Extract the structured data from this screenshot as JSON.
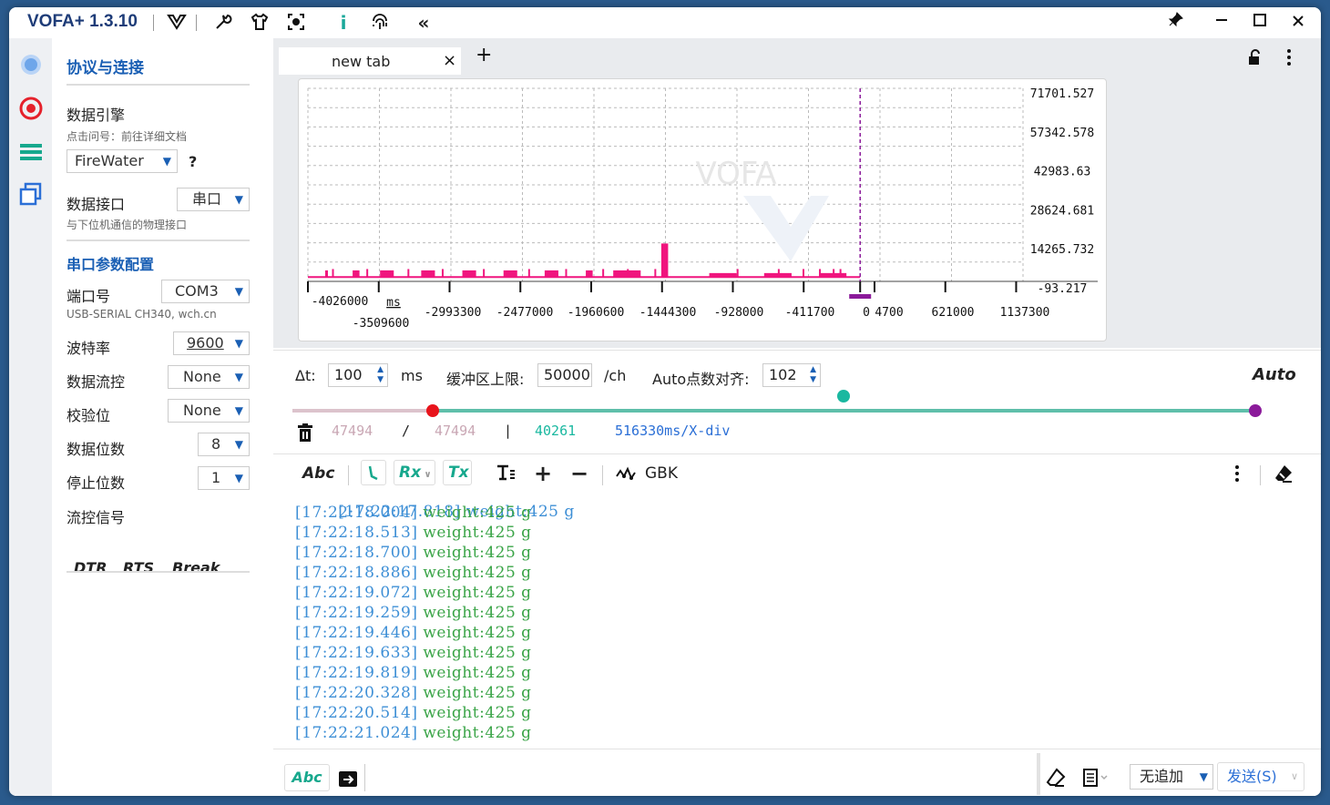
{
  "app": {
    "title": "VOFA+ 1.3.10",
    "toolbar_icons": [
      "vofa-logo-icon",
      "wrench-icon",
      "shirt-icon",
      "focus-icon",
      "info-icon",
      "fingerprint-icon",
      "collapse-icon"
    ],
    "window_controls": [
      "pin-icon",
      "minimize-icon",
      "maximize-icon",
      "close-icon"
    ]
  },
  "colors": {
    "accent": "#1a5fb4",
    "plot_series": "#f0157e",
    "cursor": "#8b1a9a",
    "slider_track": "#5fbfaa",
    "timestamp": "#3e8fd6",
    "message": "#3aa447",
    "muted_count": "#c9a7b4"
  },
  "sidebar": {
    "section_title": "协议与连接",
    "engine_label": "数据引擎",
    "engine_hint": "点击问号：前往详细文档",
    "engine_value": "FireWater",
    "help": "?",
    "interface_label": "数据接口",
    "interface_value": "串口",
    "interface_hint": "与下位机通信的物理接口",
    "serial_title": "串口参数配置",
    "port_label": "端口号",
    "port_value": "COM3",
    "port_desc": "USB-SERIAL CH340, wch.cn",
    "baud_label": "波特率",
    "baud_value": "9600",
    "flow_label": "数据流控",
    "flow_value": "None",
    "parity_label": "校验位",
    "parity_value": "None",
    "databits_label": "数据位数",
    "databits_value": "8",
    "stopbits_label": "停止位数",
    "stopbits_value": "1",
    "signal_label": "流控信号",
    "signals": [
      "DTR",
      "RTS",
      "Break"
    ]
  },
  "tabs": {
    "active_label": "new tab",
    "close": "×",
    "add": "+"
  },
  "chart_data": {
    "type": "line",
    "y_ticks": [
      "71701.527",
      "57342.578",
      "42983.63",
      "28624.681",
      "14265.732",
      "-93.217"
    ],
    "x_ticks": [
      "-4026000",
      "-3509600",
      "-2993300",
      "-2477000",
      "-1960600",
      "-1444300",
      "-928000",
      "-411700",
      "0",
      "4700",
      "621000",
      "1137300"
    ],
    "x_unit": "ms",
    "ylim": [
      -93.217,
      71701.527
    ],
    "grid": true,
    "watermark": "VOFA",
    "series": [
      {
        "values_desc": "pulse train",
        "x": [
          -4026000,
          -3900000,
          -3880000,
          -3700000,
          -3650000,
          -3500000,
          -3400000,
          -3200000,
          -3100000,
          -2900000,
          -2800000,
          -2600000,
          -2500000,
          -2300000,
          -2200000,
          -2000000,
          -1950000,
          -1800000,
          -1600000,
          -1450000,
          -1400000,
          -1200000,
          -1100000,
          -900000,
          -700000,
          -500000,
          -300000,
          -100000
        ],
        "y": [
          1000,
          4000,
          1000,
          4000,
          1000,
          4000,
          1000,
          4000,
          1000,
          4000,
          1000,
          4000,
          1000,
          4000,
          1000,
          4000,
          1000,
          4000,
          1000,
          14000,
          1000,
          1000,
          3000,
          1000,
          3000,
          1000,
          3000,
          1000
        ]
      }
    ]
  },
  "controls": {
    "dt_label": "Δt:",
    "dt_value": "100",
    "dt_unit": "ms",
    "buffer_label": "缓冲区上限:",
    "buffer_value": "50000",
    "buffer_unit": "/ch",
    "auto_label": "Auto点数对齐:",
    "auto_value": "102",
    "auto_mode": "Auto",
    "slider_mid_fraction": 0.57
  },
  "stats": {
    "count_a": "47494",
    "slash": "/",
    "count_b": "47494",
    "bar": "|",
    "count_c": "40261",
    "xdiv": "516330ms/X-div"
  },
  "log_toolbar": {
    "abc": "Abc",
    "rx": "Rx",
    "tx": "Tx",
    "encoding": "GBK"
  },
  "log": {
    "partial_line": "[17:22:17.818] weight:425 g",
    "lines": [
      {
        "ts": "[17:22:18.004]",
        "msg": "weight:425 g"
      },
      {
        "ts": "[17:22:18.513]",
        "msg": "weight:425 g"
      },
      {
        "ts": "[17:22:18.700]",
        "msg": "weight:425 g"
      },
      {
        "ts": "[17:22:18.886]",
        "msg": "weight:425 g"
      },
      {
        "ts": "[17:22:19.072]",
        "msg": "weight:425 g"
      },
      {
        "ts": "[17:22:19.259]",
        "msg": "weight:425 g"
      },
      {
        "ts": "[17:22:19.446]",
        "msg": "weight:425 g"
      },
      {
        "ts": "[17:22:19.633]",
        "msg": "weight:425 g"
      },
      {
        "ts": "[17:22:19.819]",
        "msg": "weight:425 g"
      },
      {
        "ts": "[17:22:20.328]",
        "msg": "weight:425 g"
      },
      {
        "ts": "[17:22:20.514]",
        "msg": "weight:425 g"
      },
      {
        "ts": "[17:22:21.024]",
        "msg": "weight:425 g"
      }
    ]
  },
  "send_bar": {
    "abc": "Abc",
    "append_mode": "无追加",
    "send_label": "发送(S)"
  }
}
